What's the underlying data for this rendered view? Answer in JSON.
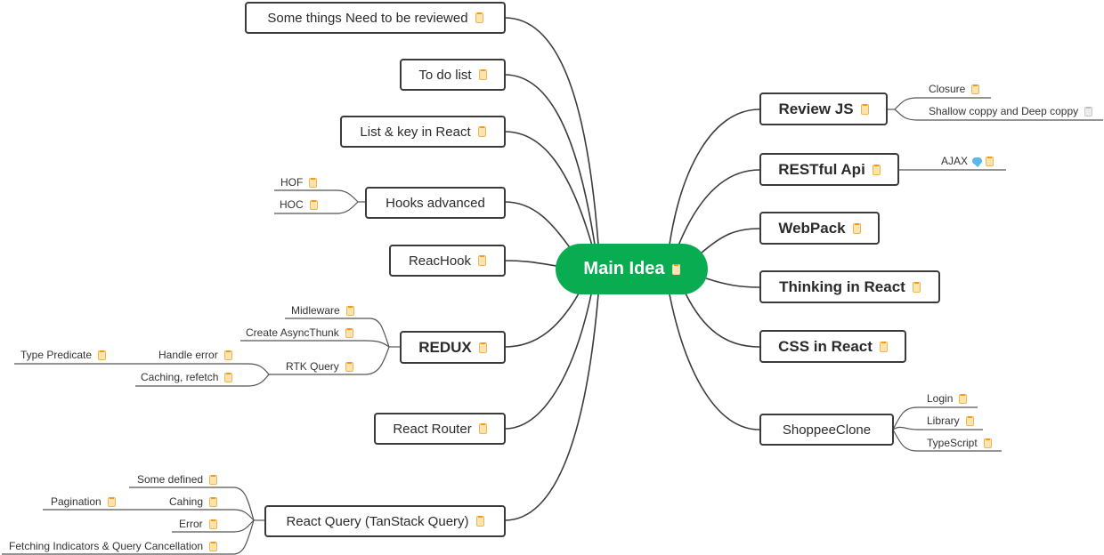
{
  "root": {
    "label": "Main Idea",
    "color": "#0aac51",
    "icon": "note-icon"
  },
  "left_topics": [
    {
      "id": "review",
      "label": "Some things Need to be reviewed",
      "icon": "note-icon",
      "children": []
    },
    {
      "id": "todo",
      "label": "To do list",
      "icon": "note-icon",
      "children": []
    },
    {
      "id": "listkey",
      "label": "List & key in React",
      "icon": "note-icon",
      "children": []
    },
    {
      "id": "hooks",
      "label": "Hooks advanced",
      "icon": "none",
      "children": [
        {
          "label": "HOF",
          "icon": "note-icon"
        },
        {
          "label": "HOC",
          "icon": "note-icon"
        }
      ]
    },
    {
      "id": "reachook",
      "label": "ReacHook",
      "icon": "note-icon",
      "children": []
    },
    {
      "id": "redux",
      "label": "REDUX",
      "icon": "note-icon",
      "children": [
        {
          "label": "Midleware",
          "icon": "note-icon"
        },
        {
          "label": "Create AsyncThunk",
          "icon": "note-icon"
        },
        {
          "label": "RTK Query",
          "icon": "note-icon",
          "children": [
            {
              "label": "Handle error",
              "icon": "note-icon",
              "children": [
                {
                  "label": "Type Predicate",
                  "icon": "note-icon"
                }
              ]
            },
            {
              "label": "Caching, refetch",
              "icon": "note-icon"
            }
          ]
        }
      ]
    },
    {
      "id": "router",
      "label": "React Router",
      "icon": "note-icon",
      "children": []
    },
    {
      "id": "query",
      "label": "React Query (TanStack Query)",
      "icon": "note-icon",
      "children": [
        {
          "label": "Some defined",
          "icon": "note-icon"
        },
        {
          "label": "Cahing",
          "icon": "note-icon",
          "children": [
            {
              "label": "Pagination",
              "icon": "note-icon"
            }
          ]
        },
        {
          "label": "Error",
          "icon": "note-icon"
        },
        {
          "label": "Fetching Indicators & Query Cancellation",
          "icon": "note-icon"
        }
      ]
    }
  ],
  "right_topics": [
    {
      "id": "reviewjs",
      "label": "Review JS",
      "icon": "note-icon",
      "children": [
        {
          "label": "Closure",
          "icon": "note-icon"
        },
        {
          "label": "Shallow coppy and Deep coppy",
          "icon": "empty-note-icon"
        }
      ]
    },
    {
      "id": "restful",
      "label": "RESTful Api",
      "icon": "note-icon",
      "children": [
        {
          "label": "AJAX",
          "icon": "note-icon",
          "comment_icon": "comment-icon"
        }
      ]
    },
    {
      "id": "webpack",
      "label": "WebPack",
      "icon": "note-icon",
      "children": []
    },
    {
      "id": "thinking",
      "label": "Thinking in React",
      "icon": "note-icon",
      "children": []
    },
    {
      "id": "css",
      "label": "CSS in React",
      "icon": "note-icon",
      "children": []
    },
    {
      "id": "shoppee",
      "label": "ShoppeeClone",
      "icon": "none",
      "children": [
        {
          "label": "Login",
          "icon": "note-icon"
        },
        {
          "label": "Library",
          "icon": "note-icon"
        },
        {
          "label": "TypeScript",
          "icon": "note-icon"
        }
      ]
    }
  ],
  "colors": {
    "line": "#3b3b3b",
    "leaf_underline": "#9a9a9a",
    "note_icon": "#f2b451",
    "comment_icon": "#59b7ec"
  }
}
